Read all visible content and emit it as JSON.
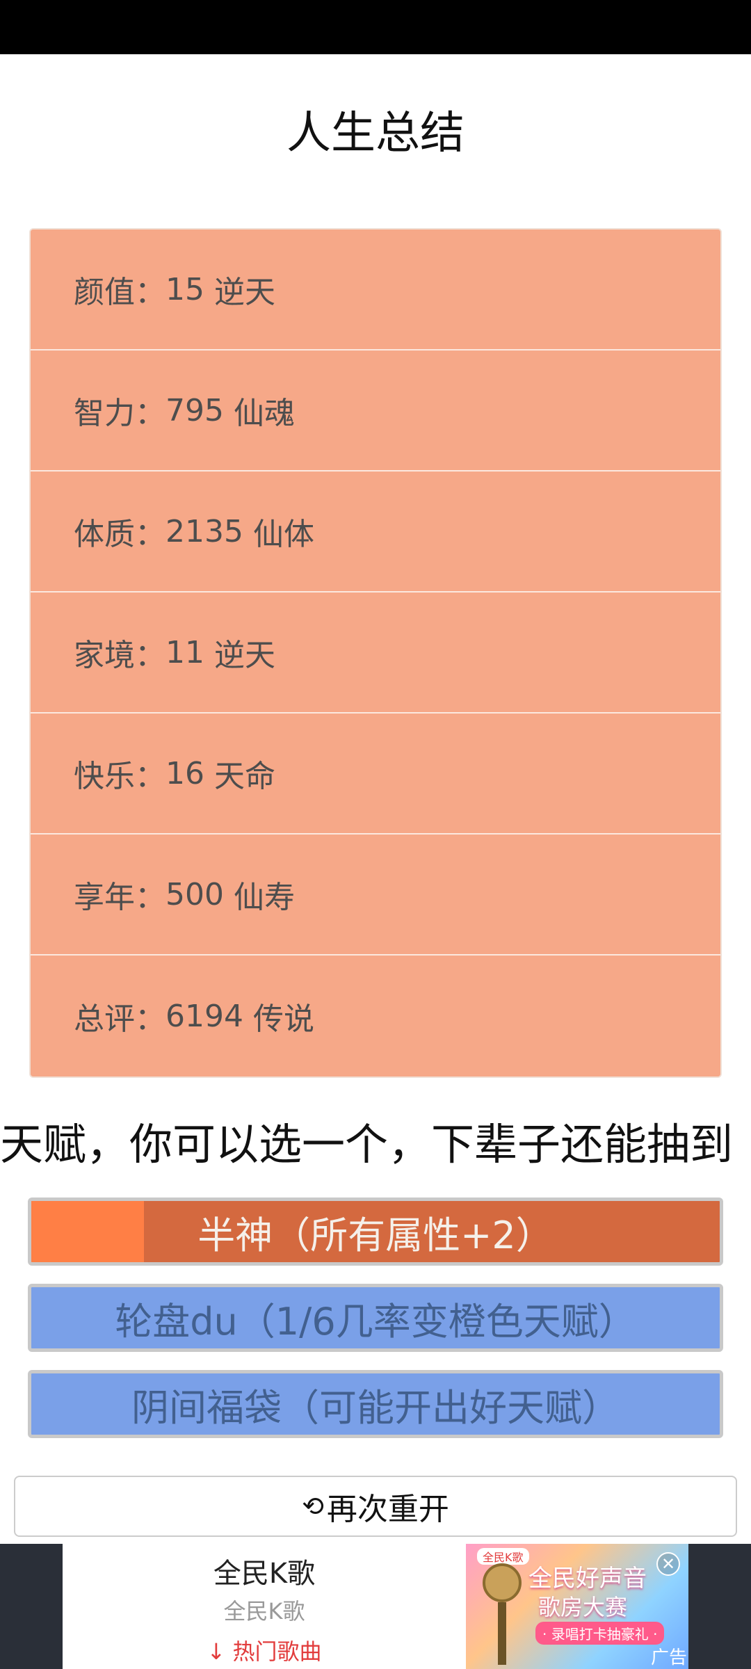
{
  "page": {
    "title": "人生总结"
  },
  "stats": [
    {
      "label": "颜值",
      "sep": "：",
      "value": "15",
      "grade": "逆天"
    },
    {
      "label": "智力",
      "sep": "：",
      "value": "795",
      "grade": "仙魂"
    },
    {
      "label": "体质",
      "sep": "：",
      "value": "2135",
      "grade": "仙体"
    },
    {
      "label": "家境",
      "sep": "：",
      "value": "11",
      "grade": "逆天"
    },
    {
      "label": "快乐",
      "sep": "：",
      "value": "16",
      "grade": "天命"
    },
    {
      "label": "享年",
      "sep": "：",
      "value": "500",
      "grade": "仙寿"
    },
    {
      "label": "总评",
      "sep": "：",
      "value": "6194",
      "grade": "传说"
    }
  ],
  "talents": {
    "header": "天赋，你可以选一个，下辈子还能抽到",
    "options": [
      {
        "label": "半神（所有属性+2）",
        "color": "#d4693f"
      },
      {
        "label": "轮盘du（1/6几率变橙色天赋）",
        "color": "#7aa0e8"
      },
      {
        "label": "阴间福袋（可能开出好天赋）",
        "color": "#7aa0e8"
      }
    ]
  },
  "restart": {
    "icon": "refresh-icon",
    "label": "再次重开"
  },
  "ad": {
    "app_name": "全民K歌",
    "app_sub": "全民K歌",
    "download_label": "热门歌曲",
    "banner_brand": "全民K歌",
    "banner_line1": "全民好声音",
    "banner_line2": "歌房大赛",
    "banner_line3": "· 录唱打卡抽豪礼 ·",
    "ad_tag": "广告"
  }
}
